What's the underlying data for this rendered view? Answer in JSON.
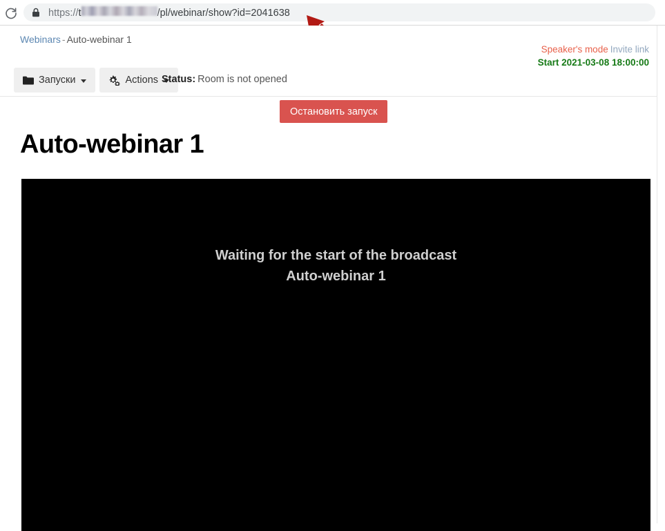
{
  "browser": {
    "reload_icon": "reload-icon",
    "lock_icon": "lock-icon",
    "url_scheme": "https://",
    "url_host_visible": "t",
    "url_host_redacted": true,
    "url_path": "/pl/webinar/show?id=2041638"
  },
  "annotation": {
    "arrow_icon": "red-arrow-annotation",
    "color": "#b21a14",
    "points_to": "url-id-parameter"
  },
  "breadcrumb": {
    "root_label": "Webinars",
    "separator": "-",
    "current_label": "Auto-webinar 1"
  },
  "header_right": {
    "speaker_mode_label": "Speaker's mode",
    "invite_link_label": "Invite link",
    "start_prefix": "Start",
    "start_datetime": "2021-03-08 18:00:00",
    "speaker_mode_color": "#e8614b",
    "invite_link_color": "#93a8bf",
    "start_color": "#167a16"
  },
  "toolbar": {
    "launches_label": "Запуски",
    "launches_icon": "folder-icon",
    "actions_label": "Actions",
    "actions_icon": "cogs-icon",
    "caret_icon": "caret-down-icon",
    "status_label": "Status:",
    "status_value": "Room is not opened",
    "stop_button_label": "Остановить запуск",
    "stop_button_color": "#d9534f"
  },
  "page": {
    "title": "Auto-webinar 1"
  },
  "video": {
    "message_line1": "Waiting for the start of the broadcast",
    "message_line2": "Auto-webinar 1",
    "background": "#000000"
  }
}
